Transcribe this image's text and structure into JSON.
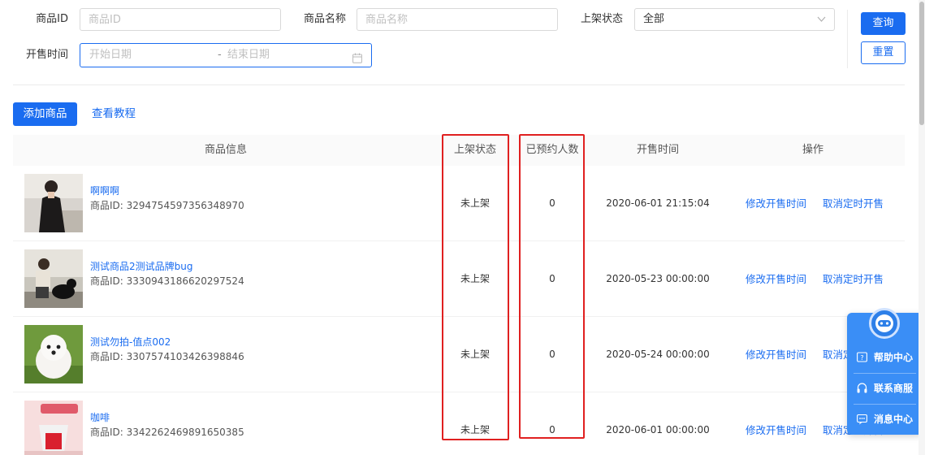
{
  "filters": {
    "product_id_label": "商品ID",
    "product_id_placeholder": "商品ID",
    "product_name_label": "商品名称",
    "product_name_placeholder": "商品名称",
    "status_label": "上架状态",
    "status_value": "全部",
    "sale_time_label": "开售时间",
    "start_date_placeholder": "开始日期",
    "date_separator": "-",
    "end_date_placeholder": "结束日期",
    "search_button": "查询",
    "reset_button": "重置"
  },
  "toolbar": {
    "add_product_button": "添加商品",
    "tutorial_link": "查看教程"
  },
  "table": {
    "headers": {
      "info": "商品信息",
      "status": "上架状态",
      "reserved": "已预约人数",
      "sale_time": "开售时间",
      "actions": "操作"
    },
    "rows": [
      {
        "name": "啊啊啊",
        "id_text": "商品ID: 3294754597356348970",
        "status": "未上架",
        "reserved": "0",
        "sale_time": "2020-06-01 21:15:04",
        "action1": "修改开售时间",
        "action2": "取消定时开售"
      },
      {
        "name": "测试商品2测试品牌bug",
        "id_text": "商品ID: 3330943186620297524",
        "status": "未上架",
        "reserved": "0",
        "sale_time": "2020-05-23 00:00:00",
        "action1": "修改开售时间",
        "action2": "取消定时开售"
      },
      {
        "name": "测试勿拍-值点002",
        "id_text": "商品ID: 3307574103426398846",
        "status": "未上架",
        "reserved": "0",
        "sale_time": "2020-05-24 00:00:00",
        "action1": "修改开售时间",
        "action2": "取消定时开售"
      },
      {
        "name": "咖啡",
        "id_text": "商品ID: 3342262469891650385",
        "status": "未上架",
        "reserved": "0",
        "sale_time": "2020-06-01 00:00:00",
        "action1": "修改开售时间",
        "action2": "取消定时开售"
      }
    ]
  },
  "widget": {
    "help_center": "帮助中心",
    "contact_service": "联系商服",
    "message_center": "消息中心"
  },
  "colors": {
    "primary": "#1a6cf0",
    "highlight": "#e02020",
    "widget": "#3a8ef6"
  }
}
